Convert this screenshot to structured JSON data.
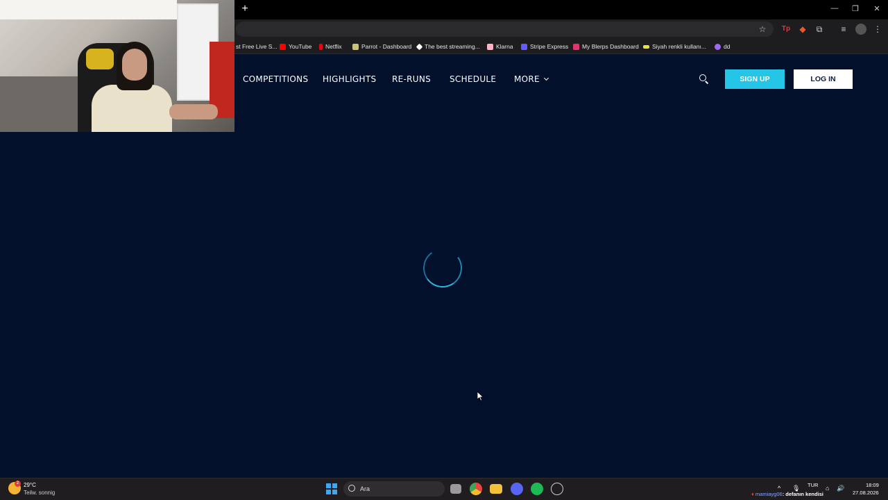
{
  "browser": {
    "newtab_label": "+",
    "window_controls": [
      "—",
      "❐",
      "✕"
    ],
    "bookmarks": [
      {
        "label": "st Free Live S...",
        "color": "#e03a3a"
      },
      {
        "label": "YouTube",
        "color": "#ff0000"
      },
      {
        "label": "Netflix",
        "color": "#e50914"
      },
      {
        "label": "Parrot - Dashboard",
        "color": "#c9c27a"
      },
      {
        "label": "The best streaming...",
        "color": "#ffffff"
      },
      {
        "label": "Klarna",
        "color": "#ffb3c7"
      },
      {
        "label": "Stripe Express",
        "color": "#635bff"
      },
      {
        "label": "My Blerps Dashboard",
        "color": "#e0346a"
      },
      {
        "label": "Siyah renkli kullanı...",
        "color": "#e8e23a"
      },
      {
        "label": "dd",
        "color": "#9b6bf2"
      }
    ]
  },
  "site": {
    "nav": [
      "COMPETITIONS",
      "HIGHLIGHTS",
      "RE-RUNS",
      "SCHEDULE",
      "MORE"
    ],
    "signup_label": "SIGN UP",
    "login_label": "LOG IN",
    "spinner_color": "#2ab7df",
    "background_color": "#03102b"
  },
  "taskbar": {
    "weather_temp": "29°C",
    "weather_desc": "Teilw. sonnig",
    "weather_badge": "2",
    "search_placeholder": "Ara",
    "language": "TUR",
    "time": "18:09",
    "date": "27.08.2026",
    "chat_user": "mamiayg06",
    "chat_message": ": defanın kendisi"
  }
}
